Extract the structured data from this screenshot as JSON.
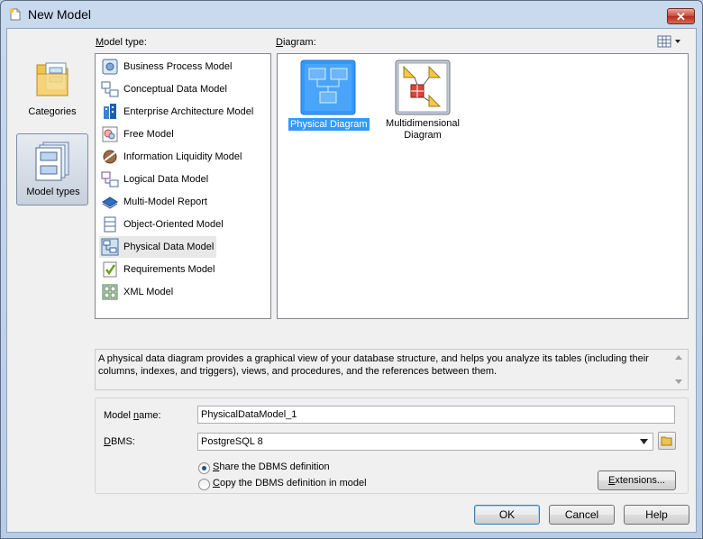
{
  "window": {
    "title": "New Model",
    "close_glyph": "✕"
  },
  "categories": [
    {
      "label": "Categories",
      "icon": "folder-icon",
      "selected": false
    },
    {
      "label": "Model types",
      "icon": "model-types-icon",
      "selected": true
    }
  ],
  "model_type": {
    "label": "Model type:",
    "items": [
      {
        "label": "Business Process Model",
        "icon": "business-process-icon"
      },
      {
        "label": "Conceptual Data Model",
        "icon": "conceptual-data-icon"
      },
      {
        "label": "Enterprise Architecture Model",
        "icon": "enterprise-architecture-icon"
      },
      {
        "label": "Free Model",
        "icon": "free-model-icon"
      },
      {
        "label": "Information Liquidity Model",
        "icon": "information-liquidity-icon"
      },
      {
        "label": "Logical Data Model",
        "icon": "logical-data-icon"
      },
      {
        "label": "Multi-Model Report",
        "icon": "multi-model-report-icon"
      },
      {
        "label": "Object-Oriented Model",
        "icon": "object-oriented-icon"
      },
      {
        "label": "Physical Data Model",
        "icon": "physical-data-icon",
        "selected": true
      },
      {
        "label": "Requirements Model",
        "icon": "requirements-icon"
      },
      {
        "label": "XML Model",
        "icon": "xml-model-icon"
      }
    ]
  },
  "diagram": {
    "label": "Diagram:",
    "view_icon": "view-options-icon",
    "items": [
      {
        "label": "Physical Diagram",
        "selected": true,
        "icon": "physical-diagram-icon"
      },
      {
        "label_line1": "Multidimensional",
        "label_line2": "Diagram",
        "selected": false,
        "icon": "multidimensional-diagram-icon"
      }
    ]
  },
  "description": "A physical data diagram provides a graphical view of your database structure, and helps you analyze its tables (including their columns, indexes, and triggers), views, and procedures, and the references between them.",
  "form": {
    "model_name_label": "Model name:",
    "model_name_value": "PhysicalDataModel_1",
    "dbms_label": "DBMS:",
    "dbms_value": "PostgreSQL 8",
    "share_label": "Share the DBMS definition",
    "copy_label": "Copy the DBMS definition in model",
    "share_selected": true,
    "extensions_label": "Extensions..."
  },
  "buttons": {
    "ok": "OK",
    "cancel": "Cancel",
    "help": "Help"
  },
  "colors": {
    "selection": "#3399ff",
    "title_bar": "#c9daee"
  }
}
